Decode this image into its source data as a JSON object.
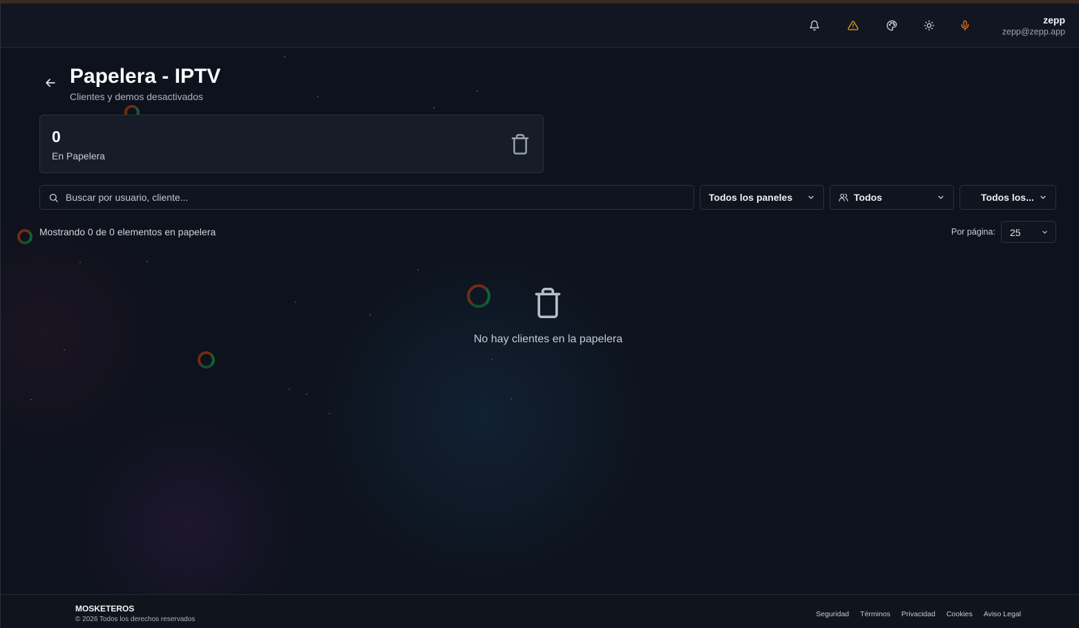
{
  "header": {
    "user_name": "zepp",
    "user_email": "zepp@zepp.app",
    "icons": [
      "bell-icon",
      "warning-icon",
      "palette-icon",
      "sun-icon",
      "microphone-icon"
    ],
    "accent_warning": "#f59e0b",
    "accent_mic": "#f97316"
  },
  "page": {
    "title": "Papelera - IPTV",
    "subtitle": "Clientes y demos desactivados"
  },
  "stat": {
    "value": "0",
    "label": "En Papelera",
    "icon": "trash-icon"
  },
  "filters": {
    "search_placeholder": "Buscar por usuario, cliente...",
    "search_value": "",
    "panels_selected": "Todos los paneles",
    "users_selected": "Todos",
    "status_selected": "Todos los..."
  },
  "results": {
    "summary": "Mostrando 0 de 0 elementos en papelera",
    "per_page_label": "Por página:",
    "per_page_value": "25"
  },
  "empty_state": {
    "icon": "trash-icon",
    "message": "No hay clientes en la papelera"
  },
  "footer": {
    "brand": "MOSKETEROS",
    "copyright": "© 2026 Todos los derechos reservados",
    "links": [
      "Seguridad",
      "Términos",
      "Privacidad",
      "Cookies",
      "Aviso Legal"
    ]
  },
  "colors": {
    "background": "#0d121c",
    "card": "#171d28",
    "border": "#2d3441"
  }
}
